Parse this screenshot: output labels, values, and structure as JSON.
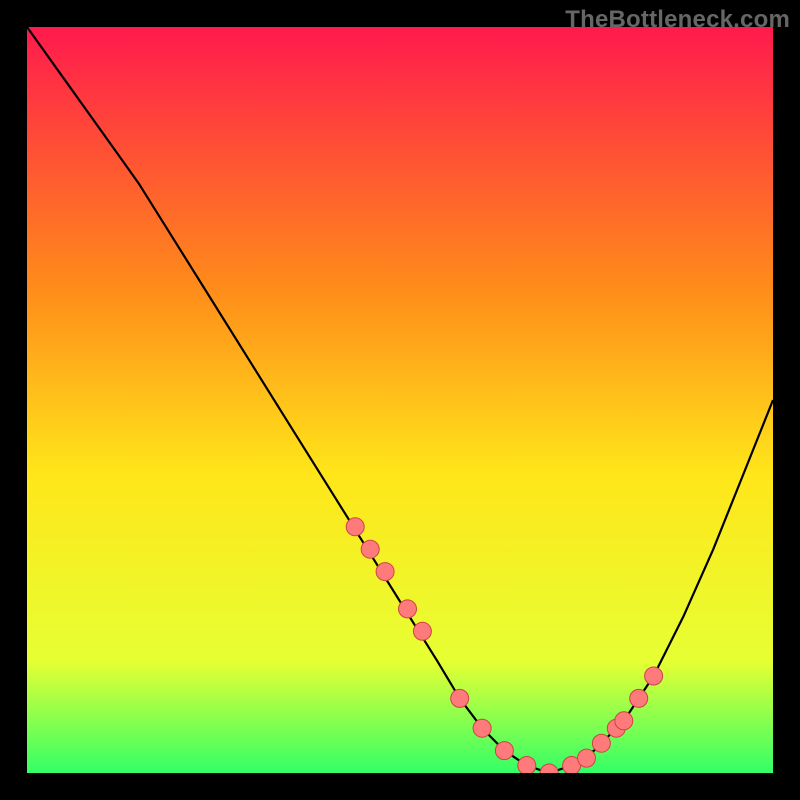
{
  "watermark": "TheBottleneck.com",
  "colors": {
    "gradient_top": "#ff1a4d",
    "gradient_mid1": "#ff8c1a",
    "gradient_mid2": "#ffe61a",
    "gradient_mid3": "#e6ff33",
    "gradient_bottom": "#33ff66",
    "curve": "#000000",
    "dot": "#ff7a7a",
    "dot_stroke": "#cc4444",
    "frame": "#000000"
  },
  "chart_data": {
    "type": "line",
    "title": "",
    "xlabel": "",
    "ylabel": "",
    "xlim": [
      0,
      100
    ],
    "ylim": [
      0,
      100
    ],
    "grid": false,
    "legend": false,
    "series": [
      {
        "name": "curve",
        "x": [
          0,
          5,
          10,
          15,
          20,
          25,
          30,
          35,
          40,
          45,
          50,
          55,
          58,
          61,
          64,
          67,
          70,
          73,
          76,
          80,
          84,
          88,
          92,
          96,
          100
        ],
        "y": [
          100,
          93,
          86,
          79,
          71,
          63,
          55,
          47,
          39,
          31,
          23,
          15,
          10,
          6,
          3,
          1,
          0,
          1,
          3,
          7,
          13,
          21,
          30,
          40,
          50
        ]
      }
    ],
    "dots": {
      "name": "highlighted-points",
      "x": [
        44,
        46,
        48,
        51,
        53,
        58,
        61,
        64,
        67,
        70,
        73,
        75,
        77,
        79,
        80,
        82,
        84
      ],
      "y": [
        33,
        30,
        27,
        22,
        19,
        10,
        6,
        3,
        1,
        0,
        1,
        2,
        4,
        6,
        7,
        10,
        13
      ]
    }
  }
}
